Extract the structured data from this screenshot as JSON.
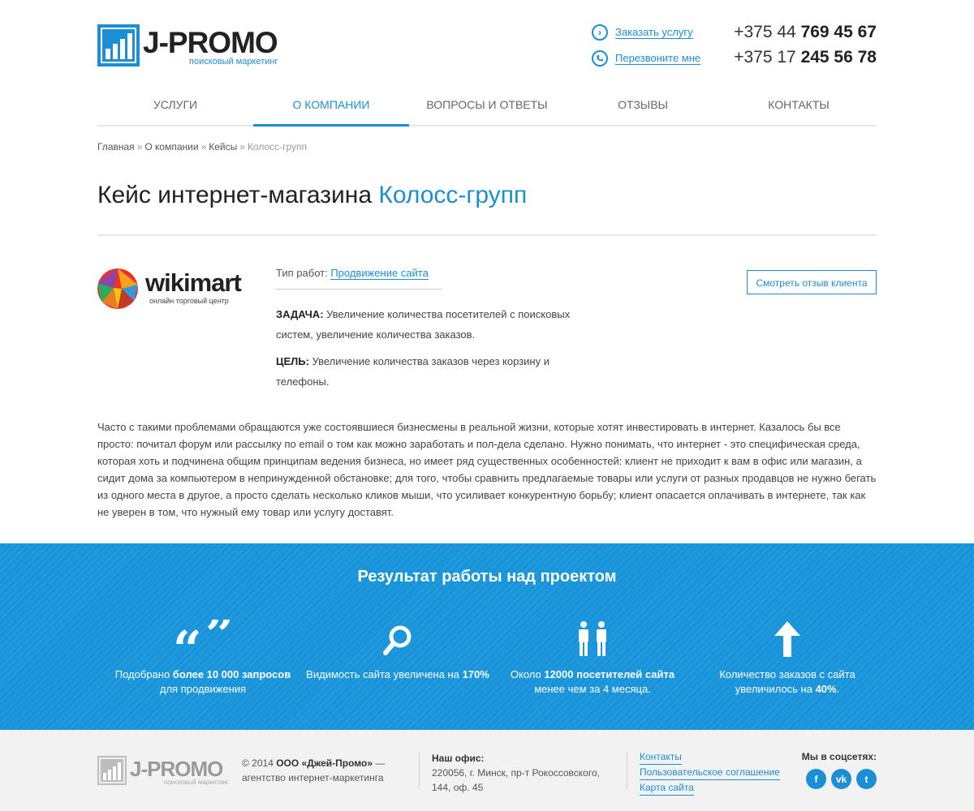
{
  "header": {
    "logo_text": "J-PROMO",
    "logo_tagline": "поисковый маркетинг",
    "order_link": "Заказать услугу",
    "callback_link": "Перезвоните мне",
    "phones": [
      {
        "prefix": "+375 44 ",
        "number": "769 45 67"
      },
      {
        "prefix": "+375 17 ",
        "number": "245 56 78"
      }
    ]
  },
  "nav": {
    "items": [
      {
        "label": "Услуги"
      },
      {
        "label": "О компании"
      },
      {
        "label": "Вопросы и ответы"
      },
      {
        "label": "Отзывы"
      },
      {
        "label": "Контакты"
      }
    ],
    "active_index": 1
  },
  "breadcrumb": [
    "Главная",
    "О компании",
    "Кейсы",
    "Колосс-групп"
  ],
  "breadcrumb_sep": "»",
  "page": {
    "title_main": "Кейс интернет-магазина ",
    "title_accent": "Колосс-групп"
  },
  "case": {
    "client_name": "wikimart",
    "client_tagline": "онлайн торговый центр",
    "work_type_label": "Тип работ: ",
    "work_type_value": "Продвижение сайта",
    "task_label": "ЗАДАЧА:",
    "task_text": " Увеличение количества посетителей с поисковых систем, увеличение количества заказов.",
    "goal_label": "ЦЕЛЬ:",
    "goal_text": " Увеличение количества заказов через корзину и телефоны.",
    "review_button": "Смотреть отзыв клиента"
  },
  "body_text": "Часто с такими проблемами обращаются уже состоявшиеся бизнесмены в реальной жизни, которые хотят инвестировать в интернет. Казалось бы все просто: почитал форум или рассылку по email о том как можно заработать и пол-дела сделано. Нужно понимать, что интернет - это специфическая среда, которая хоть и подчинена общим принципам ведения бизнеса, но имеет ряд существенных особенностей: клиент не приходит к вам в офис или магазин, а сидит дома за компьютером в непринужденной обстановке; для того, чтобы сравнить предлагаемые товары или услуги от разных продавцов не нужно бегать из одного места в другое, а просто сделать несколько кликов мыши, что усиливает конкурентную борьбу; клиент опасается оплачивать в интернете, так как не уверен в том, что нужный ему товар или услугу доставят.",
  "result": {
    "title": "Результат работы над проектом",
    "stats": [
      {
        "icon": "quote-icon",
        "t1": "Подобрано ",
        "b1": "более 10 000 запросов",
        "t2": " для продвижения"
      },
      {
        "icon": "search-icon",
        "t1": "Видимость сайта увеличена на ",
        "b1": "170%",
        "t2": ""
      },
      {
        "icon": "people-icon",
        "t1": "Около ",
        "b1": "12000 посетителей сайта",
        "t2": " менее чем за 4 месяца."
      },
      {
        "icon": "arrow-up-icon",
        "t1": "Количество заказов с сайта увеличилось на ",
        "b1": "40%",
        "t2": "."
      }
    ]
  },
  "footer": {
    "logo_text": "J-PROMO",
    "logo_tagline": "поисковый маркетинг",
    "copyright_prefix": "© 2014 ",
    "company": "ООО «Джей-Промо»",
    "copyright_suffix": " — агентство интернет-маркетинга",
    "office_label": "Наш офис:",
    "office_address": "220056, г. Минск, пр-т Рокоссовского, 144, оф. 45",
    "links": [
      "Контакты",
      "Пользовательское соглашение",
      "Карта сайта"
    ],
    "social_label": "Мы в соцсетях:",
    "social": [
      {
        "icon": "facebook-icon",
        "glyph": "f"
      },
      {
        "icon": "vk-icon",
        "glyph": "vk"
      },
      {
        "icon": "twitter-icon",
        "glyph": "t"
      }
    ]
  },
  "colors": {
    "accent": "#1a8fd6",
    "band": "#1894db",
    "footer_bg": "#f2f2f2"
  }
}
